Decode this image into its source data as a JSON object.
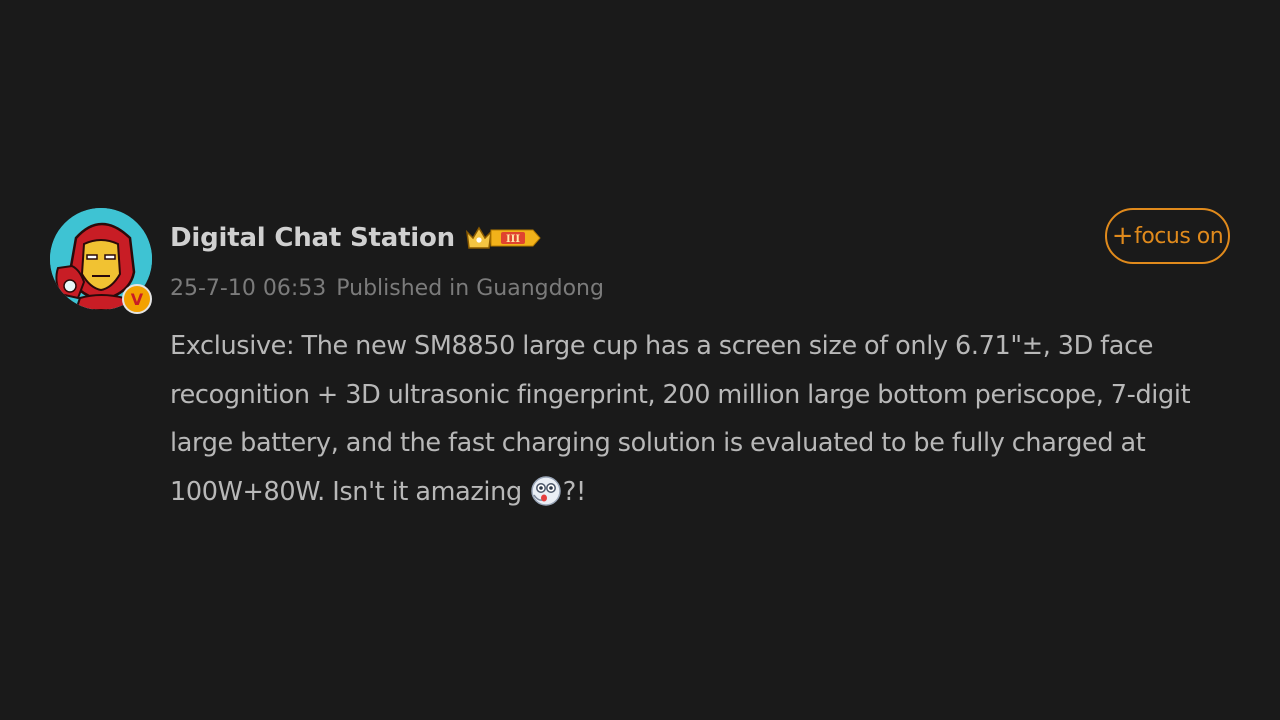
{
  "author": {
    "name": "Digital Chat Station",
    "verified_mark": "V",
    "rank_label": "III"
  },
  "post": {
    "date": "25-7-10 06:53",
    "location": "Published in Guangdong",
    "text_main": "Exclusive: The new SM8850 large cup has a screen size of only 6.71\"±, 3D face recognition + 3D ultrasonic fingerprint, 200 million large bottom periscope, 7-digit large battery, and the fast charging solution is evaluated to be fully charged at 100W+80W. Isn't it amazing",
    "text_tail": "?!",
    "emoji": "surprised-face-emoji"
  },
  "follow": {
    "plus": "+",
    "label": "focus on"
  },
  "colors": {
    "background": "#1a1a1a",
    "accent": "#e08a1c",
    "name_text": "#d0d0d0",
    "body_text": "#b8b8b8",
    "meta_text": "#7b7b7b",
    "verified": "#f2a100"
  }
}
